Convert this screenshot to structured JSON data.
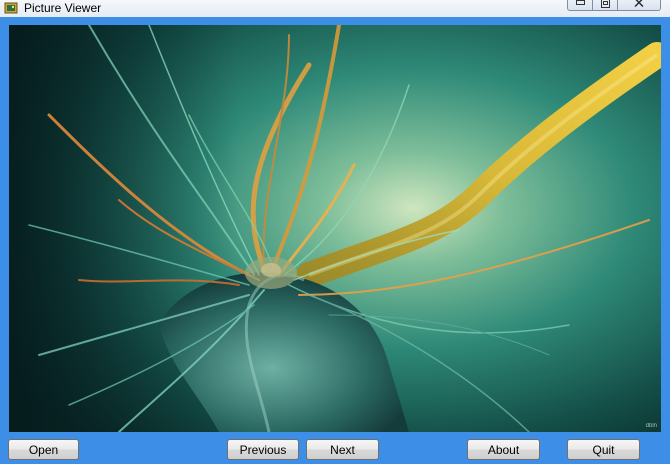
{
  "window": {
    "title": "Picture Viewer",
    "controls": [
      "minimize-icon",
      "maximize-icon",
      "close-icon"
    ]
  },
  "image": {
    "watermark": "dbln"
  },
  "buttons": {
    "open": "Open",
    "previous": "Previous",
    "next": "Next",
    "about": "About",
    "quit": "Quit"
  },
  "colors": {
    "window_frame": "#3d8ee6",
    "titlebar": "#eaf0f7"
  }
}
